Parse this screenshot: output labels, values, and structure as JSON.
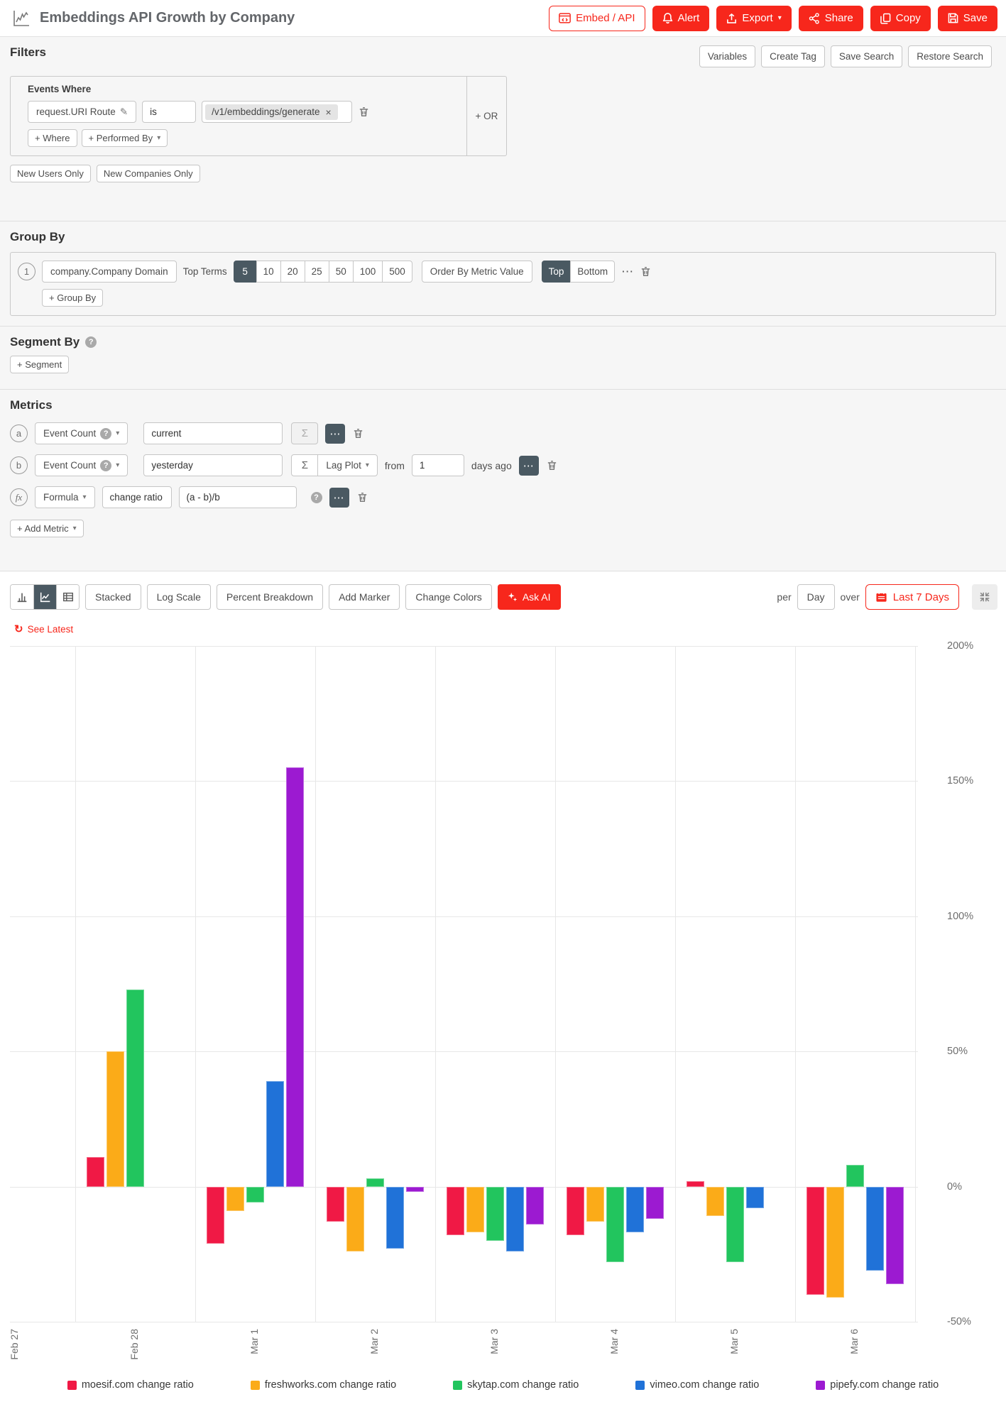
{
  "icons": {
    "caret": "▾",
    "ellipsis": "⋯",
    "sigma": "Σ",
    "pencil": "✎",
    "close": "×",
    "help": "?",
    "refresh": "↻"
  },
  "colors": {
    "accent_red": "#f7271c",
    "dark_slate": "#4a5962"
  },
  "header": {
    "title": "Embeddings API Growth by Company",
    "embed_api": "Embed / API",
    "alert": "Alert",
    "export": "Export",
    "share": "Share",
    "copy": "Copy",
    "save": "Save"
  },
  "filters": {
    "heading": "Filters",
    "variables": "Variables",
    "create_tag": "Create Tag",
    "save_search": "Save Search",
    "restore_search": "Restore Search",
    "events_where": "Events Where",
    "field": "request.URI Route",
    "operator": "is",
    "value": "/v1/embeddings/generate",
    "or_label": "+ OR",
    "add_where": "+ Where",
    "add_performed_by": "+ Performed By",
    "new_users_only": "New Users Only",
    "new_companies_only": "New Companies Only"
  },
  "group_by": {
    "heading": "Group By",
    "row_badge": "1",
    "field": "company.Company Domain",
    "top_terms_label": "Top Terms",
    "terms": [
      "5",
      "10",
      "20",
      "25",
      "50",
      "100",
      "500"
    ],
    "selected_term": "5",
    "order_by": "Order By Metric Value",
    "order_options": [
      "Top",
      "Bottom"
    ],
    "selected_order": "Top",
    "add_label": "+ Group By"
  },
  "segment_by": {
    "heading": "Segment By",
    "add_label": "+ Segment"
  },
  "metrics": {
    "heading": "Metrics",
    "add_label": "+ Add Metric",
    "row_a": {
      "badge": "a",
      "metric": "Event Count",
      "value": "current"
    },
    "row_b": {
      "badge": "b",
      "metric": "Event Count",
      "value": "yesterday",
      "aggregation": "Lag Plot",
      "from_label": "from",
      "from_value": "1",
      "suffix": "days ago"
    },
    "row_formula": {
      "badge": "fx",
      "type": "Formula",
      "name": "change ratio",
      "expression": "(a - b)/b"
    }
  },
  "toolbar": {
    "stacked": "Stacked",
    "log_scale": "Log Scale",
    "percent_breakdown": "Percent Breakdown",
    "add_marker": "Add Marker",
    "change_colors": "Change Colors",
    "ask_ai": "Ask AI",
    "per_label": "per",
    "interval": "Day",
    "over_label": "over",
    "time_range": "Last 7 Days",
    "see_latest": "See Latest"
  },
  "chart_data": {
    "type": "bar",
    "title": "Embeddings API Growth by Company",
    "x_tick_labels": [
      "Feb 27",
      "Feb 28",
      "Mar 1",
      "Mar 2",
      "Mar 3",
      "Mar 4",
      "Mar 5",
      "Mar 6"
    ],
    "y_tick_labels": [
      "200%",
      "150%",
      "100%",
      "50%",
      "0%",
      "-50%"
    ],
    "ylim": [
      -50,
      200
    ],
    "unit": "% change ratio",
    "grid": true,
    "legend_position": "bottom",
    "hatched_categories": [
      "Mar 6"
    ],
    "series": [
      {
        "name": "moesif.com change ratio",
        "color": "#f01945",
        "values": [
          null,
          11,
          -21,
          -13,
          -18,
          -18,
          2,
          -40
        ]
      },
      {
        "name": "freshworks.com change ratio",
        "color": "#fbab18",
        "values": [
          null,
          50,
          -9,
          -24,
          -17,
          -13,
          -11,
          -41
        ]
      },
      {
        "name": "skytap.com change ratio",
        "color": "#22c55e",
        "values": [
          null,
          73,
          -6,
          3,
          -20,
          -28,
          -28,
          8
        ]
      },
      {
        "name": "vimeo.com change ratio",
        "color": "#2072d8",
        "values": [
          null,
          null,
          39,
          -23,
          -24,
          -17,
          -8,
          -31
        ]
      },
      {
        "name": "pipefy.com change ratio",
        "color": "#9c1ad1",
        "values": [
          null,
          null,
          155,
          -2,
          -14,
          -12,
          null,
          -36
        ]
      }
    ]
  }
}
